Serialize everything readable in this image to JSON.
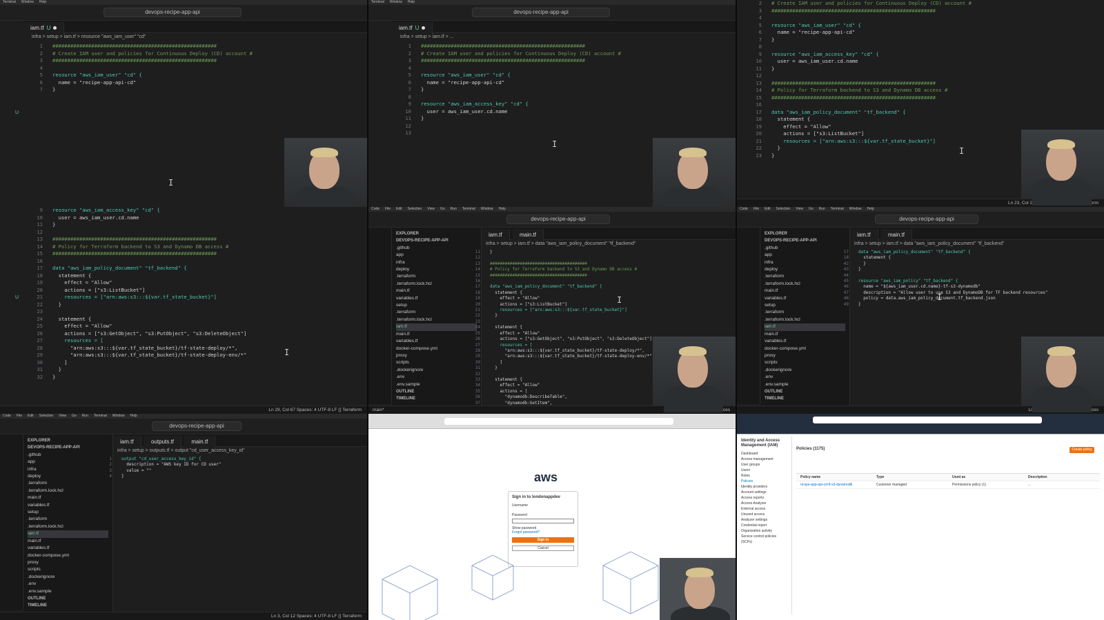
{
  "app": {
    "title": "devops-recipe-app-api"
  },
  "panel1": {
    "tab": "iam.tf",
    "tab_flag": "U",
    "crumb": "infra > setup > iam.tf > resource \"aws_iam_user\" \"cd\"",
    "lines": [
      {
        "n": "1",
        "t": "#######################################################"
      },
      {
        "n": "2",
        "t": "# Create IAM user and policies for Continuous Deploy (CD) account #"
      },
      {
        "n": "3",
        "t": "#######################################################"
      },
      {
        "n": "4",
        "t": ""
      },
      {
        "n": "5",
        "t": "resource \"aws_iam_user\" \"cd\" {"
      },
      {
        "n": "6",
        "t": "  name = \"recipe-app-api-cd\""
      },
      {
        "n": "7",
        "t": "}"
      }
    ]
  },
  "panel2": {
    "tab": "iam.tf",
    "tab_flag": "U",
    "crumb": "infra > setup > iam.tf > ...",
    "lines": [
      {
        "n": "1",
        "t": "#######################################################"
      },
      {
        "n": "2",
        "t": "# Create IAM user and policies for Continuous Deploy (CD) account #"
      },
      {
        "n": "3",
        "t": "#######################################################"
      },
      {
        "n": "4",
        "t": ""
      },
      {
        "n": "5",
        "t": "resource \"aws_iam_user\" \"cd\" {"
      },
      {
        "n": "6",
        "t": "  name = \"recipe-app-api-cd\""
      },
      {
        "n": "7",
        "t": "}"
      },
      {
        "n": "8",
        "t": ""
      },
      {
        "n": "9",
        "t": "resource \"aws_iam_access_key\" \"cd\" {"
      },
      {
        "n": "10",
        "t": "  user = aws_iam_user.cd.name"
      },
      {
        "n": "11",
        "t": "}"
      },
      {
        "n": "12",
        "t": ""
      },
      {
        "n": "13",
        "t": ""
      }
    ]
  },
  "panel3": {
    "lines": [
      {
        "n": "2",
        "t": "# Create IAM user and policies for Continuous Deploy (CD) account #"
      },
      {
        "n": "3",
        "t": "#######################################################"
      },
      {
        "n": "4",
        "t": ""
      },
      {
        "n": "5",
        "t": "resource \"aws_iam_user\" \"cd\" {"
      },
      {
        "n": "6",
        "t": "  name = \"recipe-app-api-cd\""
      },
      {
        "n": "7",
        "t": "}"
      },
      {
        "n": "8",
        "t": ""
      },
      {
        "n": "9",
        "t": "resource \"aws_iam_access_key\" \"cd\" {"
      },
      {
        "n": "10",
        "t": "  user = aws_iam_user.cd.name"
      },
      {
        "n": "11",
        "t": "}"
      },
      {
        "n": "12",
        "t": ""
      },
      {
        "n": "13",
        "t": "#######################################################"
      },
      {
        "n": "14",
        "t": "# Policy for Terraform backend to S3 and Dynamo DB access #"
      },
      {
        "n": "15",
        "t": "#######################################################"
      },
      {
        "n": "16",
        "t": ""
      },
      {
        "n": "17",
        "t": "data \"aws_iam_policy_document\" \"tf_backend\" {"
      },
      {
        "n": "18",
        "t": "  statement {"
      },
      {
        "n": "19",
        "t": "    effect = \"Allow\""
      },
      {
        "n": "20",
        "t": "    actions = [\"s3:ListBucket\"]"
      },
      {
        "n": "21",
        "t": "    resources = [\"arn:aws:s3:::${var.tf_state_bucket}\"]"
      },
      {
        "n": "22",
        "t": "  }"
      },
      {
        "n": "23",
        "t": "}"
      }
    ],
    "status": "Ln 23, Col 2   Spaces: 4   UTF-8   LF   {} Terraform"
  },
  "panel4": {
    "lines": [
      {
        "n": "9",
        "t": "resource \"aws_iam_access_key\" \"cd\" {"
      },
      {
        "n": "10",
        "t": "  user = aws_iam_user.cd.name"
      },
      {
        "n": "11",
        "t": "}"
      },
      {
        "n": "12",
        "t": ""
      },
      {
        "n": "13",
        "t": "#######################################################"
      },
      {
        "n": "14",
        "t": "# Policy for Terraform backend to S3 and Dynamo DB access #"
      },
      {
        "n": "15",
        "t": "#######################################################"
      },
      {
        "n": "16",
        "t": ""
      },
      {
        "n": "17",
        "t": "data \"aws_iam_policy_document\" \"tf_backend\" {"
      },
      {
        "n": "18",
        "t": "  statement {"
      },
      {
        "n": "19",
        "t": "    effect = \"Allow\""
      },
      {
        "n": "20",
        "t": "    actions = [\"s3:ListBucket\"]"
      },
      {
        "n": "21",
        "t": "    resources = [\"arn:aws:s3:::${var.tf_state_bucket}\"]"
      },
      {
        "n": "22",
        "t": "  }"
      },
      {
        "n": "23",
        "t": ""
      },
      {
        "n": "24",
        "t": "  statement {"
      },
      {
        "n": "25",
        "t": "    effect = \"Allow\""
      },
      {
        "n": "26",
        "t": "    actions = [\"s3:GetObject\", \"s3:PutObject\", \"s3:DeleteObject\"]"
      },
      {
        "n": "27",
        "t": "    resources = ["
      },
      {
        "n": "28",
        "t": "      \"arn:aws:s3:::${var.tf_state_bucket}/tf-state-deploy/*\","
      },
      {
        "n": "29",
        "t": "      \"arn:aws:s3:::${var.tf_state_bucket}/tf-state-deploy-env/*\""
      },
      {
        "n": "30",
        "t": "    ]"
      },
      {
        "n": "31",
        "t": "  }"
      },
      {
        "n": "32",
        "t": "}"
      }
    ],
    "status": "Ln 29, Col 67   Spaces: 4   UTF-8   LF   {} Terraform"
  },
  "explorer": {
    "header": "EXPLORER",
    "root": "DEVOPS-RECIPE-APP-API",
    "items": [
      ".github",
      "app",
      "infra",
      "deploy",
      ".terraform",
      ".terraform.lock.hcl",
      "main.tf",
      "variables.tf",
      "setup",
      ".terraform",
      ".terraform.lock.hcl",
      "iam.tf",
      "main.tf",
      "variables.tf",
      "docker-compose.yml",
      "proxy",
      "scripts",
      ".dockerignore",
      ".env",
      ".env.sample"
    ],
    "outline": "OUTLINE",
    "timeline": "TIMELINE"
  },
  "panel5": {
    "tabs": [
      "iam.tf",
      "main.tf"
    ],
    "crumb": "infra > setup > iam.tf > data \"aws_iam_policy_document\" \"tf_backend\"",
    "lines": [
      {
        "n": "11",
        "t": "}"
      },
      {
        "n": "12",
        "t": ""
      },
      {
        "n": "13",
        "t": "#######################################"
      },
      {
        "n": "14",
        "t": "# Policy for Terraform backend to S3 and Dynamo DB access #"
      },
      {
        "n": "15",
        "t": "#######################################"
      },
      {
        "n": "16",
        "t": ""
      },
      {
        "n": "17",
        "t": "data \"aws_iam_policy_document\" \"tf_backend\" {"
      },
      {
        "n": "18",
        "t": "  statement {"
      },
      {
        "n": "19",
        "t": "    effect = \"Allow\""
      },
      {
        "n": "20",
        "t": "    actions = [\"s3:ListBucket\"]"
      },
      {
        "n": "21",
        "t": "    resources = [\"arn:aws:s3:::${var.tf_state_bucket}\"]"
      },
      {
        "n": "22",
        "t": "  }"
      },
      {
        "n": "23",
        "t": ""
      },
      {
        "n": "24",
        "t": "  statement {"
      },
      {
        "n": "25",
        "t": "    effect = \"Allow\""
      },
      {
        "n": "26",
        "t": "    actions = [\"s3:GetObject\", \"s3:PutObject\", \"s3:DeleteObject\"]"
      },
      {
        "n": "27",
        "t": "    resources = ["
      },
      {
        "n": "28",
        "t": "      \"arn:aws:s3:::${var.tf_state_bucket}/tf-state-deploy/*\","
      },
      {
        "n": "29",
        "t": "      \"arn:aws:s3:::${var.tf_state_bucket}/tf-state-deploy-env/*\""
      },
      {
        "n": "30",
        "t": "    ]"
      },
      {
        "n": "31",
        "t": "  }"
      },
      {
        "n": "32",
        "t": ""
      },
      {
        "n": "33",
        "t": "  statement {"
      },
      {
        "n": "34",
        "t": "    effect = \"Allow\""
      },
      {
        "n": "35",
        "t": "    actions = ["
      },
      {
        "n": "36",
        "t": "      \"dynamodb:DescribeTable\","
      },
      {
        "n": "37",
        "t": "      \"dynamodb:GetItem\","
      }
    ],
    "status_left": "main*",
    "status_right": "Ln 17, Col 48   Spaces"
  },
  "panel6": {
    "tabs": [
      "iam.tf",
      "main.tf"
    ],
    "crumb": "infra > setup > iam.tf > data \"aws_iam_policy_document\" \"tf_backend\"",
    "lines": [
      {
        "n": "17",
        "t": "data \"aws_iam_policy_document\" \"tf_backend\" {"
      },
      {
        "n": "18",
        "t": "  statement {"
      },
      {
        "n": "42",
        "t": "  }"
      },
      {
        "n": "43",
        "t": "}"
      },
      {
        "n": "44",
        "t": ""
      },
      {
        "n": "45",
        "t": "resource \"aws_iam_policy\" \"tf_backend\" {"
      },
      {
        "n": "46",
        "t": "  name = \"${aws_iam_user.cd.name}-tf-s3-dynamodb\""
      },
      {
        "n": "47",
        "t": "  description = \"Allow user to use S3 and DynamoDB for TF backend resources\""
      },
      {
        "n": "48",
        "t": "  policy = data.aws_iam_policy_document.tf_backend.json"
      },
      {
        "n": "49",
        "t": "}"
      }
    ],
    "status_right": "Ln 17, Col 43 (10 selected)   Spaces"
  },
  "panel7": {
    "tabs": [
      "iam.tf",
      "outputs.tf",
      "main.tf"
    ],
    "crumb": "infra > setup > outputs.tf > output \"cd_user_access_key_id\"",
    "lines": [
      {
        "n": "1",
        "t": "output \"cd_user_access_key_id\" {"
      },
      {
        "n": "2",
        "t": "  description = \"AWS key ID for CD user\""
      },
      {
        "n": "3",
        "t": "  value = \"\""
      },
      {
        "n": "4",
        "t": "}"
      }
    ],
    "status": "Ln 3, Col 12   Spaces: 4   UTF-8   LF   {} Terraform"
  },
  "aws_signin": {
    "logo": "aws",
    "heading": "Sign in to londonappdev",
    "username_label": "Username",
    "password_label": "Password",
    "show_password": "Show password",
    "forgot": "Forgot password?",
    "signin_btn": "Sign in",
    "cancel_btn": "Cancel"
  },
  "iam": {
    "side_title": "Identity and Access Management (IAM)",
    "side_items": [
      "Dashboard",
      "Access management",
      "User groups",
      "Users",
      "Roles",
      "Policies",
      "Identity providers",
      "Account settings",
      "Access reports",
      "Access Analyzer",
      "External access",
      "Unused access",
      "Analyzer settings",
      "Credential report",
      "Organization activity",
      "Service control policies (SCPs)"
    ],
    "policies_title": "Policies (1175)",
    "create_btn": "Create policy",
    "columns": [
      "Policy name",
      "Type",
      "Used as",
      "Description"
    ],
    "row": {
      "name": "recipe-app-api-cd-tf-s3-dynamodb",
      "type": "Customer managed",
      "used": "Permissions policy (1)",
      "desc": "..."
    }
  }
}
